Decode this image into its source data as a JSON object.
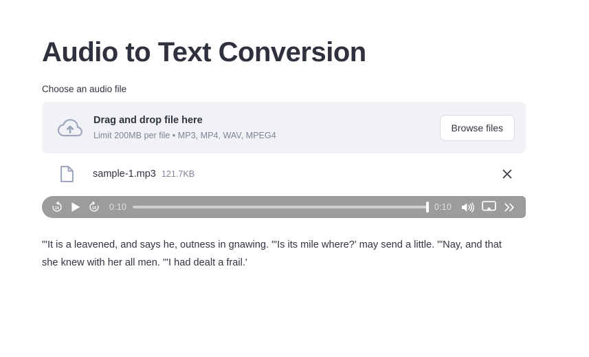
{
  "page": {
    "title": "Audio to Text Conversion"
  },
  "uploader": {
    "label": "Choose an audio file",
    "dropzone_primary": "Drag and drop file here",
    "dropzone_secondary": "Limit 200MB per file • MP3, MP4, WAV, MPEG4",
    "browse_label": "Browse files",
    "upload_icon": "cloud-upload-icon"
  },
  "uploaded_file": {
    "icon": "file-icon",
    "name": "sample-1.mp3",
    "size": "121.7KB",
    "remove_icon": "close-icon"
  },
  "audio_player": {
    "skip_back_label": "15",
    "skip_forward_label": "15",
    "play_icon": "play-icon",
    "current_time": "0:10",
    "duration": "0:10",
    "progress_percent": 100,
    "volume_icon": "volume-high-icon",
    "cast_icon": "airplay-icon",
    "more_icon": "chevron-double-right-icon",
    "track_color": "#cfcfcf",
    "bar_color": "#9c9c9c"
  },
  "transcript": {
    "text": "\"'It is a leavened, and says he, outness in gnawing. \"'Is its mile where?' may send a little. \"'Nay, and that she knew with her all men. \"'I had dealt a frail.'"
  },
  "theme": {
    "background": "#ffffff",
    "text": "#31333f",
    "muted_text": "#808495",
    "dropzone_bg": "#f0f2f6",
    "icon_blue_gray": "#9aa4bd"
  }
}
